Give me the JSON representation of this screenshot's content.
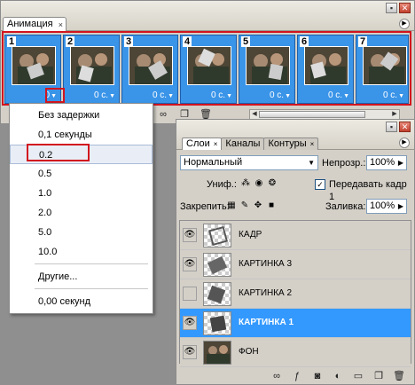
{
  "animation_panel": {
    "tab_label": "Анимация",
    "tab_close": "×",
    "frames": [
      {
        "number": "1",
        "delay": "0"
      },
      {
        "number": "2",
        "delay": "0 с."
      },
      {
        "number": "3",
        "delay": "0 с."
      },
      {
        "number": "4",
        "delay": "0 с."
      },
      {
        "number": "5",
        "delay": "0 с."
      },
      {
        "number": "6",
        "delay": "0 с."
      },
      {
        "number": "7",
        "delay": "0 с."
      }
    ],
    "delay_arrow": "▼"
  },
  "delay_menu": {
    "items": [
      "Без задержки",
      "0,1 секунды",
      "0.2",
      "0.5",
      "1.0",
      "2.0",
      "5.0",
      "10.0",
      "Другие...",
      "0,00 секунд"
    ],
    "highlighted": "0.2"
  },
  "layers_panel": {
    "tabs": [
      "Слои",
      "Каналы",
      "Контуры"
    ],
    "blend_mode": "Нормальный",
    "opacity_label": "Непрозр.:",
    "opacity_value": "100%",
    "unify_label": "Униф.:",
    "propagate_label": "Передавать кадр 1",
    "propagate_checked": "✓",
    "lock_label": "Закрепить:",
    "fill_label": "Заливка:",
    "fill_value": "100%",
    "layers": [
      {
        "name": "КАДР",
        "visible": true
      },
      {
        "name": "КАРТИНКА 3",
        "visible": true
      },
      {
        "name": "КАРТИНКА 2",
        "visible": false
      },
      {
        "name": "КАРТИНКА 1",
        "visible": true,
        "selected": true
      },
      {
        "name": "ФОН",
        "visible": true
      }
    ]
  },
  "icons": {
    "eye": "eye-icon",
    "checkbox": "checkbox-icon"
  },
  "colors": {
    "selection": "#3399ff",
    "highlight_border": "#d2141e",
    "panel_bg": "#d4d0c8"
  }
}
